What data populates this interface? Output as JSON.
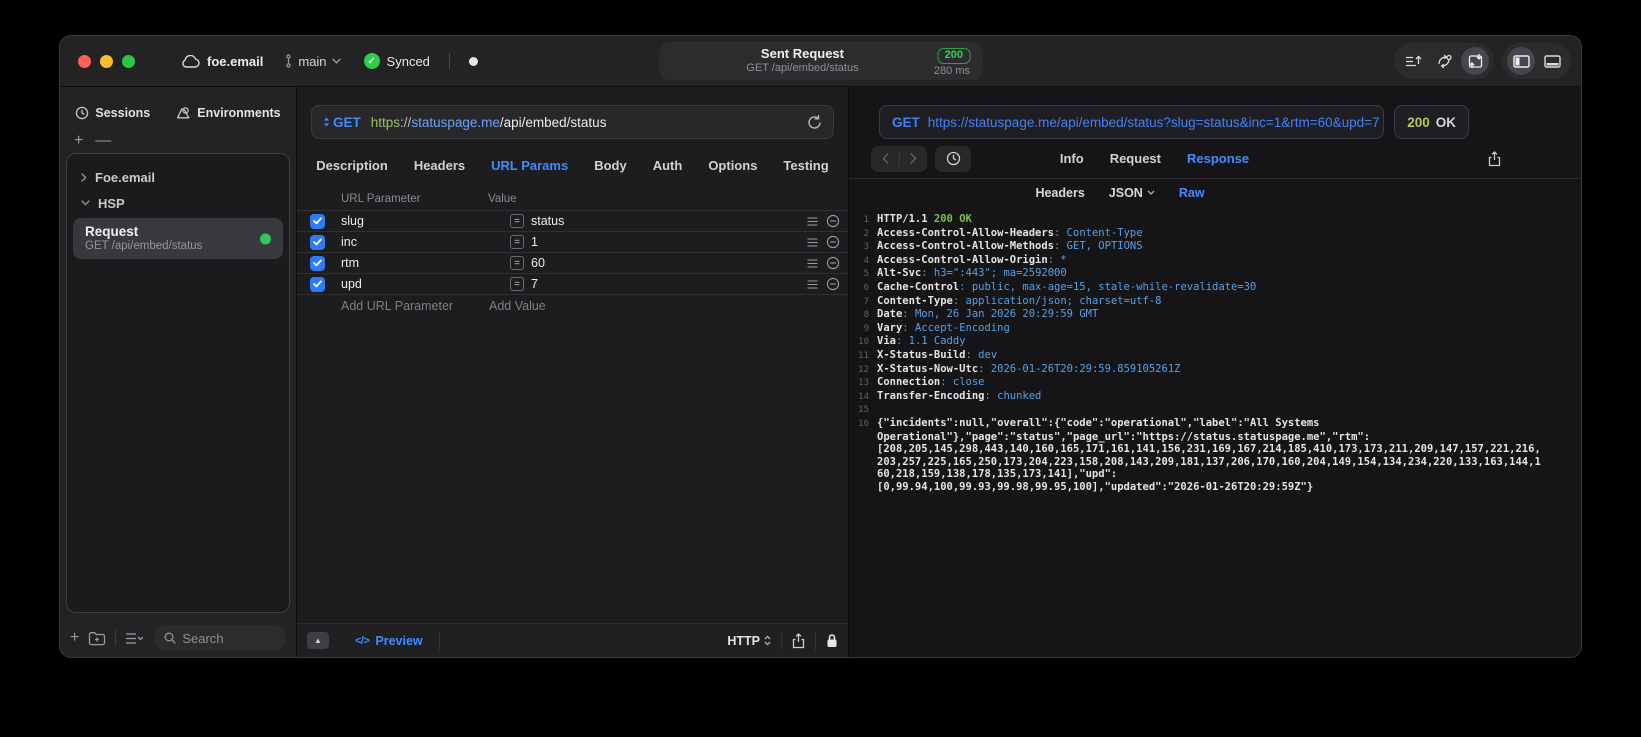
{
  "titlebar": {
    "workspace": "foe.email",
    "branch": "main",
    "sync_label": "Synced",
    "request_title": "Sent Request",
    "request_subtitle": "GET /api/embed/status",
    "status_code": "200",
    "duration": "280 ms"
  },
  "sidebar": {
    "tabs": [
      {
        "label": "Sessions",
        "icon": "clock-icon"
      },
      {
        "label": "Environments",
        "icon": "environments-icon"
      }
    ],
    "tree": [
      {
        "label": "Foe.email",
        "state": "collapsed"
      },
      {
        "label": "HSP",
        "state": "expanded"
      }
    ],
    "request_item": {
      "title": "Request",
      "subtitle": "GET /api/embed/status"
    },
    "search_placeholder": "Search"
  },
  "request_editor": {
    "method": "GET",
    "url": {
      "scheme": "https",
      "separator": "://",
      "host": "statuspage.me",
      "path": "/api/embed/status"
    },
    "tabs": [
      "Description",
      "Headers",
      "URL Params",
      "Body",
      "Auth",
      "Options",
      "Testing"
    ],
    "active_tab": "URL Params",
    "params": {
      "columns": [
        "URL Parameter",
        "Value"
      ],
      "rows": [
        {
          "name": "slug",
          "value": "status",
          "enabled": true
        },
        {
          "name": "inc",
          "value": "1",
          "enabled": true
        },
        {
          "name": "rtm",
          "value": "60",
          "enabled": true
        },
        {
          "name": "upd",
          "value": "7",
          "enabled": true
        }
      ],
      "add_name_placeholder": "Add URL Parameter",
      "add_value_placeholder": "Add Value"
    },
    "footer": {
      "preview_label": "Preview",
      "code_icon": "</>",
      "protocol": "HTTP"
    }
  },
  "response_viewer": {
    "method": "GET",
    "url": "https://statuspage.me/api/embed/status?slug=status&inc=1&rtm=60&upd=7",
    "status_code": "200",
    "status_text": "OK",
    "tabs": [
      "Info",
      "Request",
      "Response"
    ],
    "active_tab": "Response",
    "subtabs": [
      "Headers",
      "JSON",
      "Raw"
    ],
    "active_subtab": "Raw",
    "lines": [
      {
        "n": "1",
        "segs": [
          {
            "t": "HTTP/1.1 ",
            "c": "plain"
          },
          {
            "t": "200 OK",
            "c": "green"
          }
        ]
      },
      {
        "n": "2",
        "segs": [
          {
            "t": "Access-Control-Allow-Headers",
            "c": "name"
          },
          {
            "t": ": ",
            "c": "colon"
          },
          {
            "t": "Content-Type",
            "c": "val"
          }
        ]
      },
      {
        "n": "3",
        "segs": [
          {
            "t": "Access-Control-Allow-Methods",
            "c": "name"
          },
          {
            "t": ": ",
            "c": "colon"
          },
          {
            "t": "GET, OPTIONS",
            "c": "val"
          }
        ]
      },
      {
        "n": "4",
        "segs": [
          {
            "t": "Access-Control-Allow-Origin",
            "c": "name"
          },
          {
            "t": ": ",
            "c": "colon"
          },
          {
            "t": "*",
            "c": "val"
          }
        ]
      },
      {
        "n": "5",
        "segs": [
          {
            "t": "Alt-Svc",
            "c": "name"
          },
          {
            "t": ": ",
            "c": "colon"
          },
          {
            "t": "h3=\":443\"; ma=2592000",
            "c": "val"
          }
        ]
      },
      {
        "n": "6",
        "segs": [
          {
            "t": "Cache-Control",
            "c": "name"
          },
          {
            "t": ": ",
            "c": "colon"
          },
          {
            "t": "public, max-age=15, stale-while-revalidate=30",
            "c": "val"
          }
        ]
      },
      {
        "n": "7",
        "segs": [
          {
            "t": "Content-Type",
            "c": "name"
          },
          {
            "t": ": ",
            "c": "colon"
          },
          {
            "t": "application/json; charset=utf-8",
            "c": "val"
          }
        ]
      },
      {
        "n": "8",
        "segs": [
          {
            "t": "Date",
            "c": "name"
          },
          {
            "t": ": ",
            "c": "colon"
          },
          {
            "t": "Mon, 26 Jan 2026 20:29:59 GMT",
            "c": "val"
          }
        ]
      },
      {
        "n": "9",
        "segs": [
          {
            "t": "Vary",
            "c": "name"
          },
          {
            "t": ": ",
            "c": "colon"
          },
          {
            "t": "Accept-Encoding",
            "c": "val"
          }
        ]
      },
      {
        "n": "10",
        "segs": [
          {
            "t": "Via",
            "c": "name"
          },
          {
            "t": ": ",
            "c": "colon"
          },
          {
            "t": "1.1 Caddy",
            "c": "val"
          }
        ]
      },
      {
        "n": "11",
        "segs": [
          {
            "t": "X-Status-Build",
            "c": "name"
          },
          {
            "t": ": ",
            "c": "colon"
          },
          {
            "t": "dev",
            "c": "val"
          }
        ]
      },
      {
        "n": "12",
        "segs": [
          {
            "t": "X-Status-Now-Utc",
            "c": "name"
          },
          {
            "t": ": ",
            "c": "colon"
          },
          {
            "t": "2026-01-26T20:29:59.859105261Z",
            "c": "val"
          }
        ]
      },
      {
        "n": "13",
        "segs": [
          {
            "t": "Connection",
            "c": "name"
          },
          {
            "t": ": ",
            "c": "colon"
          },
          {
            "t": "close",
            "c": "val"
          }
        ]
      },
      {
        "n": "14",
        "segs": [
          {
            "t": "Transfer-Encoding",
            "c": "name"
          },
          {
            "t": ": ",
            "c": "colon"
          },
          {
            "t": "chunked",
            "c": "val"
          }
        ]
      },
      {
        "n": "15",
        "segs": []
      },
      {
        "n": "16",
        "segs": [
          {
            "t": "{\"incidents\":null,\"overall\":{\"code\":\"operational\",\"label\":\"All Systems",
            "c": "plain"
          }
        ]
      },
      {
        "n": "",
        "segs": [
          {
            "t": "Operational\"},\"page\":\"status\",\"page_url\":\"https://status.statuspage.me\",\"rtm\":",
            "c": "plain"
          }
        ]
      },
      {
        "n": "",
        "segs": [
          {
            "t": "[208,205,145,298,443,140,160,165,171,161,141,156,231,169,167,214,185,410,173,173,211,209,147,157,221,216,",
            "c": "plain"
          }
        ]
      },
      {
        "n": "",
        "segs": [
          {
            "t": "203,257,225,165,250,173,204,223,158,208,143,209,181,137,206,170,160,204,149,154,134,234,220,133,163,144,1",
            "c": "plain"
          }
        ]
      },
      {
        "n": "",
        "segs": [
          {
            "t": "60,218,159,138,178,135,173,141],\"upd\":",
            "c": "plain"
          }
        ]
      },
      {
        "n": "",
        "segs": [
          {
            "t": "[0,99.94,100,99.93,99.98,99.95,100],\"updated\":\"2026-01-26T20:29:59Z\"}",
            "c": "plain"
          }
        ]
      }
    ]
  },
  "colors": {
    "accent_blue": "#3f8cff",
    "success_green": "#30d158",
    "checkbox_blue": "#2f7bf7",
    "header_value_blue": "#55a1e6",
    "status_green": "#7abf3f"
  }
}
